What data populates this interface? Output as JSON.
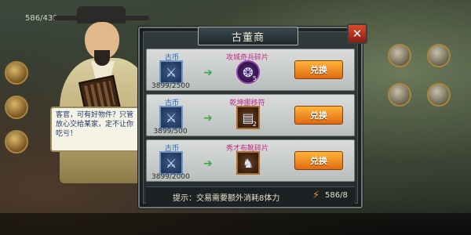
{
  "hud": {
    "resource_value": "586/430"
  },
  "speech": {
    "text": "客官，可有好物件？只管放心交给某家，定不让你吃亏！"
  },
  "dialog": {
    "title": "古董商",
    "close_icon": "close-icon",
    "rows": [
      {
        "cost_label": "古币",
        "cost_qty": "3899/2500",
        "reward_label": "攻城奇兵碎片",
        "reward_count": "5",
        "button_label": "兑换",
        "reward_icon": "purple-orb-icon"
      },
      {
        "cost_label": "古币",
        "cost_qty": "3899/500",
        "reward_label": "乾坤挪移符",
        "reward_count": "2",
        "button_label": "兑换",
        "reward_icon": "scroll-icon"
      },
      {
        "cost_label": "古币",
        "cost_qty": "3899/2000",
        "reward_label": "秀才布靴碎片",
        "reward_count": "",
        "button_label": "兑换",
        "reward_icon": "boots-icon"
      }
    ],
    "tip": {
      "text": "提示：交易需要额外消耗8体力",
      "energy_value": "586/8"
    }
  },
  "colors": {
    "accent_orange": "#f08a20",
    "reward_label": "#c22a8a",
    "cost_label": "#1f64b4"
  }
}
